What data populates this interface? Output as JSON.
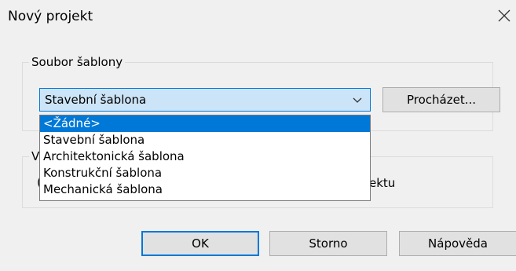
{
  "dialog": {
    "title": "Nový projekt"
  },
  "template_group": {
    "legend": "Soubor šablony",
    "combo_value": "Stavební šablona",
    "browse_label": "Procházet..."
  },
  "dropdown": {
    "items": [
      {
        "label": "<Žádné>",
        "selected": true
      },
      {
        "label": "Stavební šablona",
        "selected": false
      },
      {
        "label": "Architektonická šablona",
        "selected": false
      },
      {
        "label": "Konstrukční šablona",
        "selected": false
      },
      {
        "label": "Mechanická šablona",
        "selected": false
      }
    ]
  },
  "create_group": {
    "legend_partial": "V",
    "radio_partial": "(",
    "radio_suffix_partial": "ektu"
  },
  "buttons": {
    "ok": "OK",
    "cancel": "Storno",
    "help": "Nápověda"
  },
  "colors": {
    "dialog_bg": "#f0f0f0",
    "accent": "#0078d7",
    "combo_bg": "#cce4f7",
    "button_bg": "#e1e1e1"
  }
}
